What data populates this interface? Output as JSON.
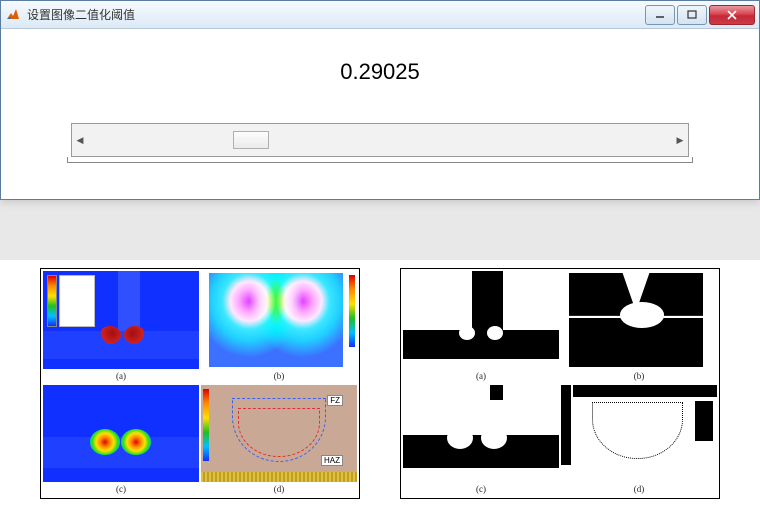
{
  "window": {
    "title": "设置图像二值化阈值"
  },
  "slider": {
    "value_text": "0.29025",
    "value": 0.29025,
    "min": 0,
    "max": 1,
    "thumb_left_pct": 29.0
  },
  "figures": {
    "left": {
      "captions": {
        "a": "(a)",
        "b": "(b)",
        "c": "(c)",
        "d": "(d)"
      },
      "d_labels": {
        "fz": "FZ",
        "haz": "HAZ"
      }
    },
    "right": {
      "captions": {
        "a": "(a)",
        "b": "(b)",
        "c": "(c)",
        "d": "(d)"
      }
    }
  }
}
